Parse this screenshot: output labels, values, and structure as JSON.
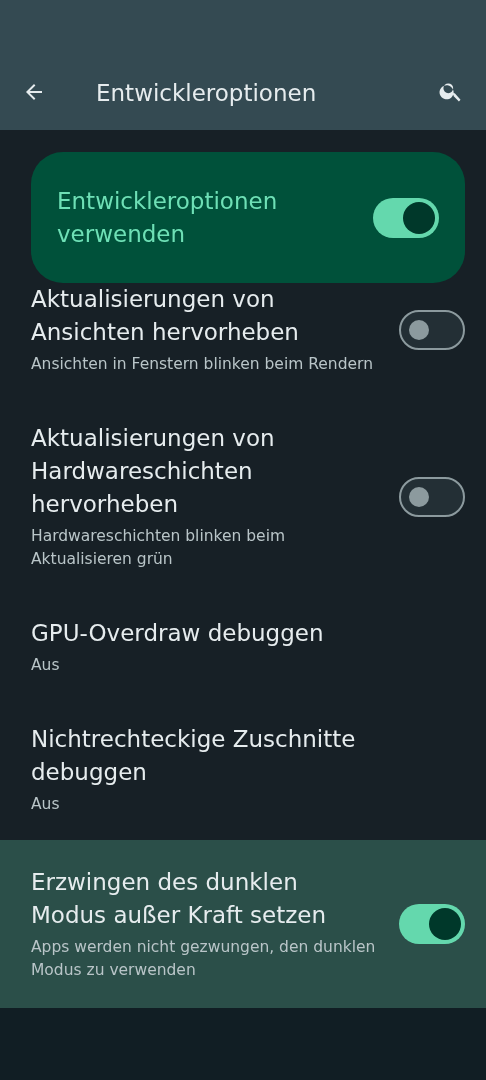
{
  "app_bar": {
    "title": "Entwickleroptionen"
  },
  "master_switch": {
    "label": "Entwickleroptionen verwenden",
    "on": true
  },
  "settings": [
    {
      "kind": "switch",
      "title": "Aktualisierungen von Ansichten hervorheben",
      "summary": "Ansichten in Fenstern blinken beim Rendern",
      "on": false,
      "selected": false
    },
    {
      "kind": "switch",
      "title": "Aktualisierungen von Hardwareschichten hervorheben",
      "summary": "Hardwareschichten blinken beim Aktualisieren grün",
      "on": false,
      "selected": false
    },
    {
      "kind": "plain",
      "title": "GPU-Overdraw debuggen",
      "summary": "Aus",
      "selected": false
    },
    {
      "kind": "plain",
      "title": "Nichtrechteckige Zuschnitte debuggen",
      "summary": "Aus",
      "selected": false
    },
    {
      "kind": "switch",
      "title": "Erzwingen des dunklen Modus außer Kraft setzen",
      "summary": "Apps werden nicht gezwungen, den dunklen Modus zu verwenden",
      "on": true,
      "selected": true
    }
  ]
}
